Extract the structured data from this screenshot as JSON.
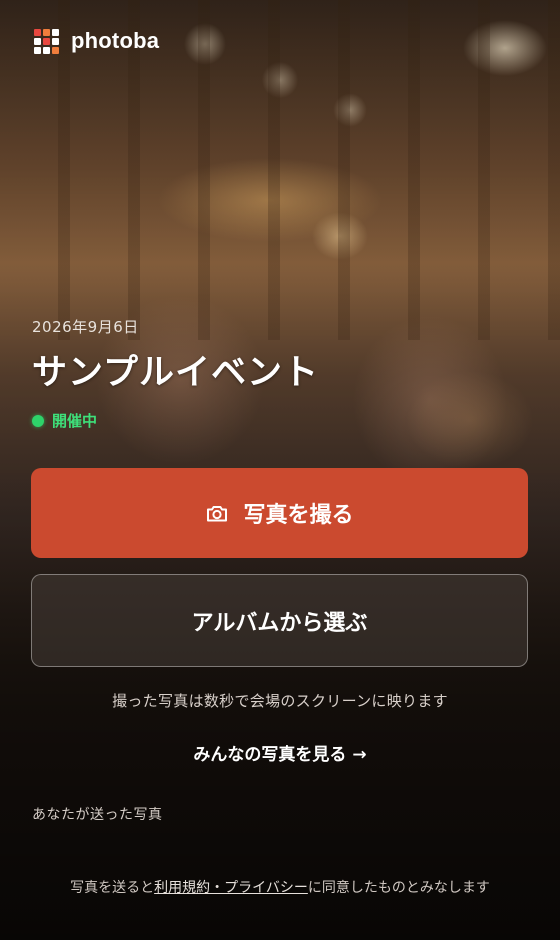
{
  "brand": {
    "name": "photoba",
    "grid_colors": [
      "#e8473f",
      "#f07d3c",
      "#ffffff",
      "#ffffff",
      "#e8473f",
      "#ffffff",
      "#ffffff",
      "#ffffff",
      "#f07d3c"
    ]
  },
  "event": {
    "date": "2026年9月6日",
    "title": "サンプルイベント",
    "status": "開催中",
    "status_color": "#2ed36a"
  },
  "actions": {
    "take_photo_label": "写真を撮る",
    "take_photo_icon": "camera-icon",
    "take_photo_color": "#cb4a2f",
    "choose_album_label": "アルバムから選ぶ"
  },
  "notice": "撮った写真は数秒で会場のスクリーンに映ります",
  "view_all": {
    "label": "みんなの写真を見る",
    "arrow": "→"
  },
  "sent_section_label": "あなたが送った写真",
  "footer": {
    "prefix": "写真を送ると",
    "link": "利用規約・プライバシー",
    "suffix": "に同意したものとみなします"
  }
}
